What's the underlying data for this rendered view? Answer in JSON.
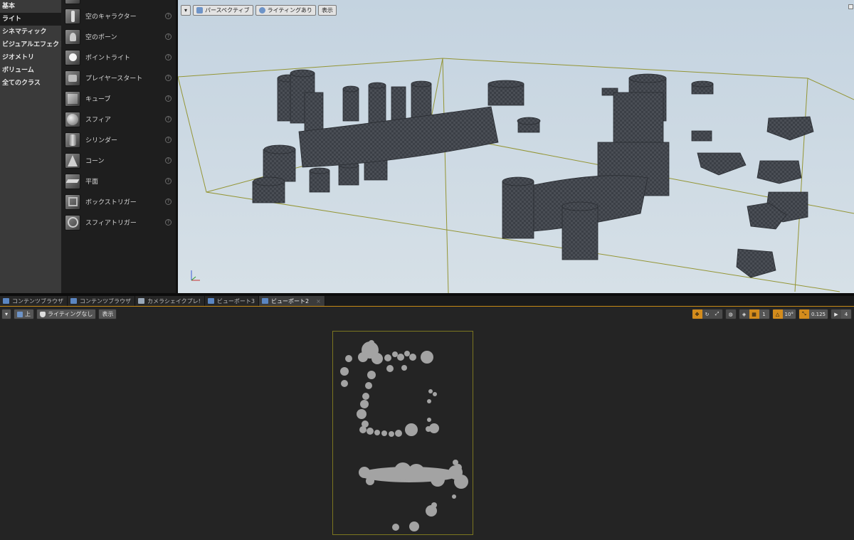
{
  "categories": [
    {
      "label": "基本",
      "active": false
    },
    {
      "label": "ライト",
      "active": true
    },
    {
      "label": "シネマティック",
      "active": false
    },
    {
      "label": "ビジュアルエフェクト",
      "active": false
    },
    {
      "label": "ジオメトリ",
      "active": false
    },
    {
      "label": "ボリューム",
      "active": false
    },
    {
      "label": "全てのクラス",
      "active": false
    }
  ],
  "assets": [
    {
      "label": "空のキャラクター",
      "icon": "character-icon"
    },
    {
      "label": "空のポーン",
      "icon": "pawn-icon"
    },
    {
      "label": "ポイントライト",
      "icon": "point-light-icon"
    },
    {
      "label": "プレイヤースタート",
      "icon": "player-start-icon"
    },
    {
      "label": "キューブ",
      "icon": "cube-icon"
    },
    {
      "label": "スフィア",
      "icon": "sphere-icon"
    },
    {
      "label": "シリンダー",
      "icon": "cylinder-icon"
    },
    {
      "label": "コーン",
      "icon": "cone-icon"
    },
    {
      "label": "平面",
      "icon": "plane-icon"
    },
    {
      "label": "ボックストリガー",
      "icon": "box-trigger-icon"
    },
    {
      "label": "スフィアトリガー",
      "icon": "sphere-trigger-icon"
    }
  ],
  "help_glyph": "?",
  "viewport3d": {
    "menu_glyph": "▾",
    "perspective_label": "パースペクティブ",
    "lighting_label": "ライティングあり",
    "show_label": "表示"
  },
  "tabs": [
    {
      "label": "コンテンツブラウザ",
      "active": false
    },
    {
      "label": "コンテンツブラウザ",
      "active": false
    },
    {
      "label": "カメラシェイクプレ!",
      "active": false
    },
    {
      "label": "ビューポート3",
      "active": false
    },
    {
      "label": "ビューポート2",
      "active": true
    }
  ],
  "tab_close_glyph": "×",
  "topview": {
    "menu_glyph": "▾",
    "view_label": "上",
    "lighting_label": "ライティングなし",
    "show_label": "表示",
    "grid_snap_value": "1",
    "rotation_snap_value": "10°",
    "scale_snap_value": "0.125",
    "camera_speed_value": "4"
  },
  "colors": {
    "accent": "#d48c1c",
    "sky": "#cbd8e2",
    "bounds_line": "#8a8a24",
    "rock": "#3e4249"
  }
}
